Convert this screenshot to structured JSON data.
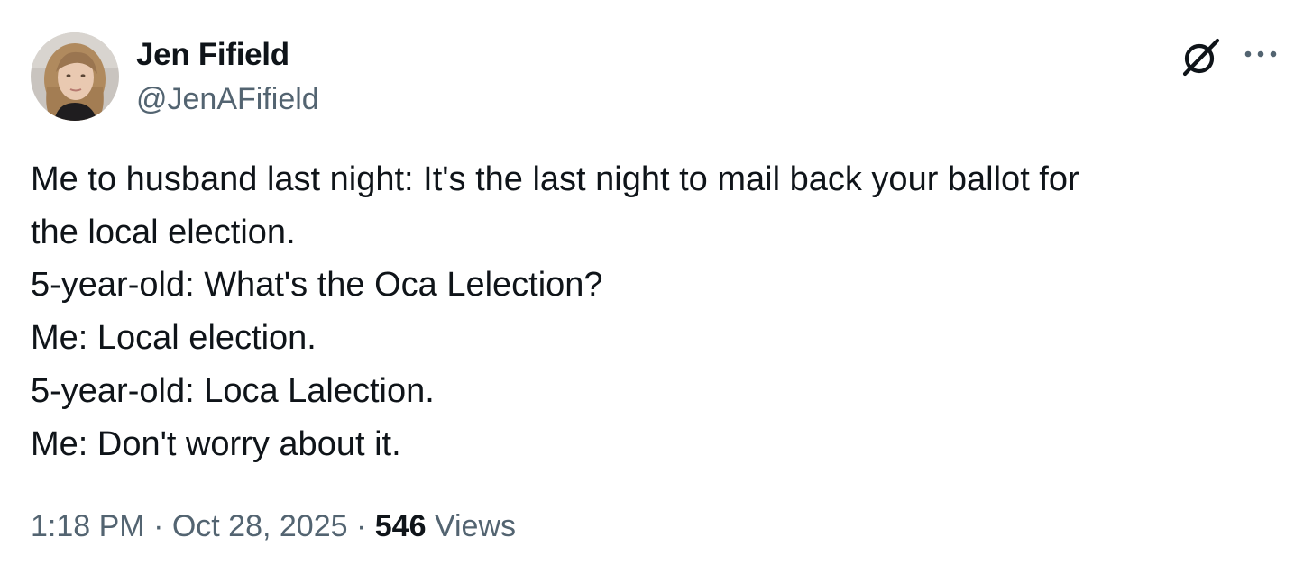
{
  "author": {
    "display_name": "Jen Fifield",
    "handle": "@JenAFifield"
  },
  "tweet": {
    "lines": [
      "Me to husband last night: It's the last night to mail back your ballot for",
      "the local election.",
      "5-year-old: What's the Oca Lelection?",
      "Me: Local election.",
      "5-year-old: Loca Lalection.",
      "Me: Don't worry about it."
    ]
  },
  "meta": {
    "time": "1:18 PM",
    "separator": " · ",
    "date": "Oct 28, 2025",
    "views_count": "546",
    "views_label": "Views"
  },
  "icons": {
    "grok": "grok-icon",
    "more": "more-icon"
  },
  "colors": {
    "text_primary": "#0f1419",
    "text_secondary": "#536471",
    "background": "#ffffff"
  }
}
